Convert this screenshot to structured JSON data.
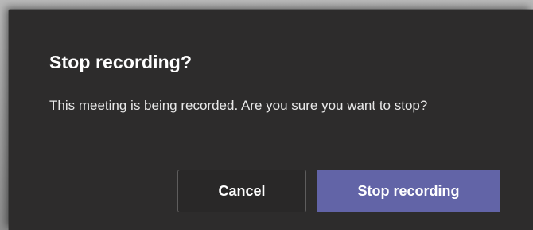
{
  "dialog": {
    "title": "Stop recording?",
    "message": "This meeting is being recorded. Are you sure you want to stop?",
    "cancel_label": "Cancel",
    "confirm_label": "Stop recording"
  },
  "colors": {
    "dialog_background": "#2d2c2c",
    "primary_accent": "#6264a7"
  }
}
